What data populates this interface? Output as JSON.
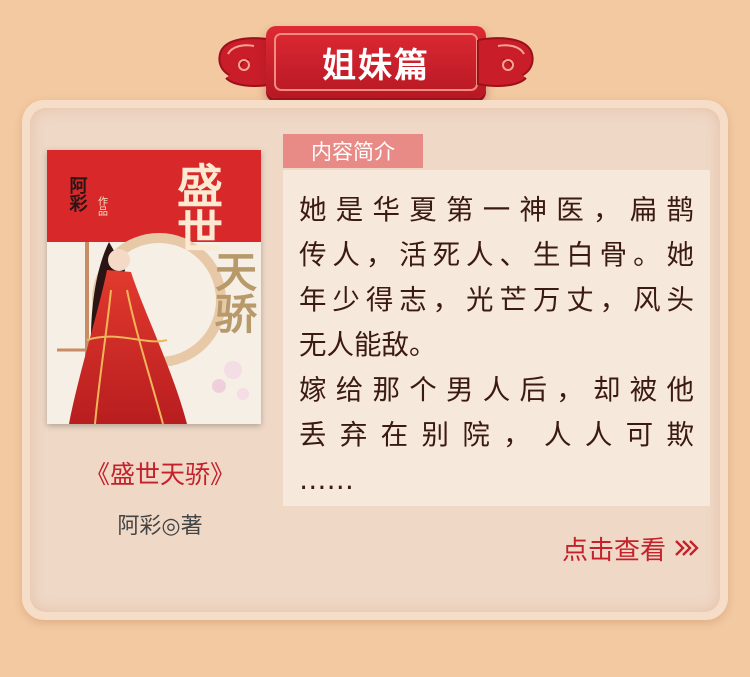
{
  "header": {
    "title": "姐妹篇"
  },
  "book": {
    "title": "《盛世天骄》",
    "author": "阿彩◎著",
    "cover": {
      "title_line1": "盛世",
      "title_line2": "天骄",
      "author": "阿彩",
      "byline": "作品"
    }
  },
  "intro": {
    "label": "内容简介",
    "lines": [
      "她是华夏第一神医，扁鹊",
      "传人，活死人、生白骨。她",
      "年少得志，光芒万丈，风头",
      "无人能敌。",
      "嫁给那个男人后，却被他",
      "丢弃在别院，人人可欺",
      "……"
    ]
  },
  "actions": {
    "view_more": "点击查看"
  },
  "colors": {
    "background": "#f2c9a1",
    "accent_red": "#c3212b",
    "banner_red": "#de2a34",
    "label_pink": "#e88a86"
  },
  "icons": {
    "banner_decoration": "cloud-scroll-icon",
    "view_more": "double-chevron-right-icon"
  }
}
